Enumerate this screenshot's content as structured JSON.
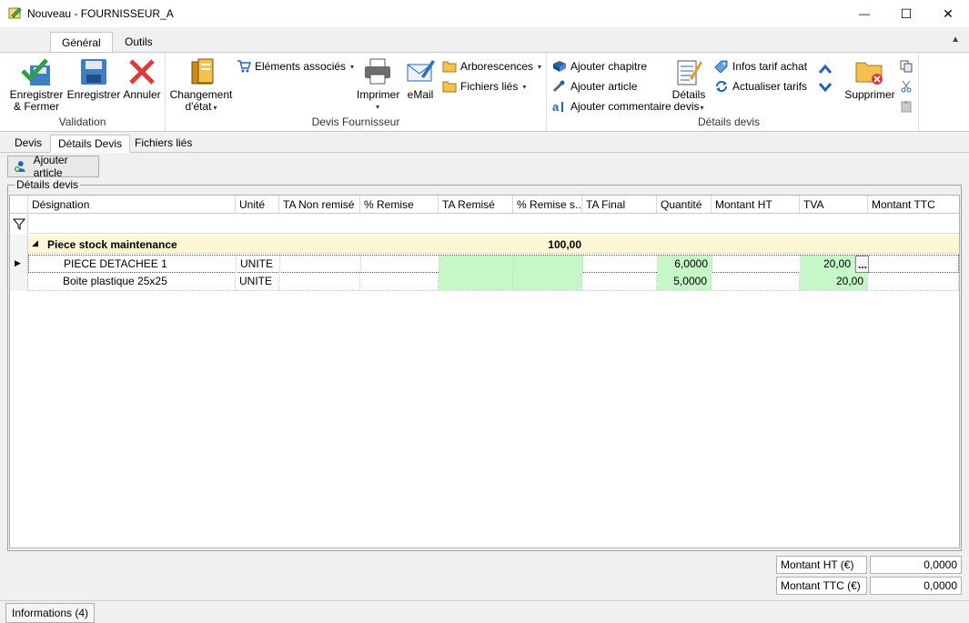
{
  "window": {
    "title": "Nouveau - FOURNISSEUR_A",
    "minimize_glyph": "—",
    "maximize_glyph": "☐",
    "close_glyph": "✕"
  },
  "ribbon_tabs": [
    "Général",
    "Outils"
  ],
  "ribbon": {
    "validation": {
      "label": "Validation",
      "save_close": "Enregistrer\n& Fermer",
      "save": "Enregistrer",
      "cancel": "Annuler"
    },
    "devis_fournisseur": {
      "label": "Devis Fournisseur",
      "change_state": "Changement\nd'état",
      "elements": "Eléments associés",
      "print": "Imprimer",
      "email": "eMail",
      "tree": "Arborescences",
      "linked_files": "Fichiers liés"
    },
    "details_devis": {
      "label": "Détails devis",
      "add_chapter": "Ajouter chapitre",
      "add_article": "Ajouter article",
      "add_comment": "Ajouter commentaire",
      "details": "Détails\ndevis",
      "purchase_info": "Infos tarif achat",
      "update_prices": "Actualiser tarifs",
      "delete": "Supprimer"
    }
  },
  "doc_tabs": [
    "Devis",
    "Détails Devis",
    "Fichiers liés"
  ],
  "toolbar": {
    "add_article": "Ajouter article"
  },
  "section_title": "Détails devis",
  "grid": {
    "columns": [
      "Désignation",
      "Unité",
      "TA Non remisé",
      "% Remise",
      "TA Remisé",
      "% Remise s...",
      "TA Final",
      "Quantité",
      "Montant HT",
      "TVA",
      "Montant TTC"
    ],
    "group": {
      "name": "Piece stock maintenance",
      "value": "100,00"
    },
    "rows": [
      {
        "designation": "PIECE DETACHEE 1",
        "unit": "UNITE",
        "qty": "6,0000",
        "tva": "20,00"
      },
      {
        "designation": "Boite plastique 25x25",
        "unit": "UNITE",
        "qty": "5,0000",
        "tva": "20,00"
      }
    ],
    "ellipsis": "..."
  },
  "totals": {
    "ht_label": "Montant HT (€)",
    "ht_value": "0,0000",
    "ttc_label": "Montant TTC (€)",
    "ttc_value": "0,0000"
  },
  "status": {
    "info": "Informations (4)"
  },
  "colors": {
    "accent": "#1e6fc6",
    "green_cell": "#c6f7c6",
    "group_row": "#fcf6d2"
  }
}
